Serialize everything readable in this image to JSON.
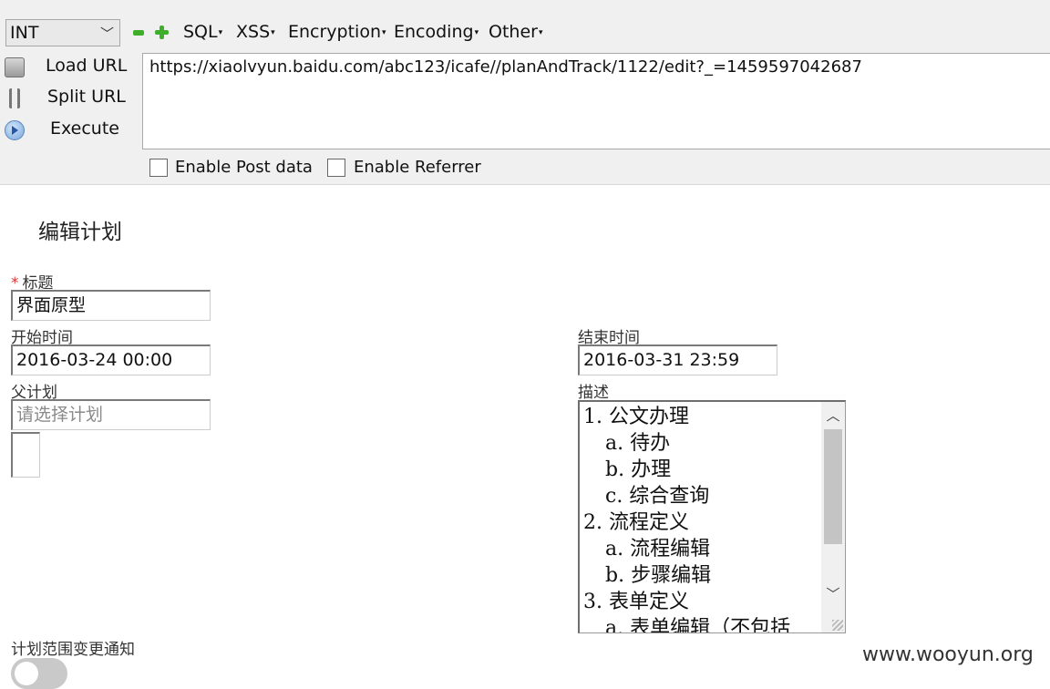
{
  "hackbar": {
    "type_select": "INT",
    "menus": {
      "sql": "SQL",
      "xss": "XSS",
      "encryption": "Encryption",
      "encoding": "Encoding",
      "other": "Other"
    },
    "buttons": {
      "load_url": "Load URL",
      "split_url": "Split URL",
      "execute": "Execute"
    },
    "url": "https://xiaolvyun.baidu.com/abc123/icafe//planAndTrack/1122/edit?_=1459597042687",
    "checkboxes": {
      "post_data": "Enable Post data",
      "referrer": "Enable Referrer"
    },
    "icons": {
      "minus": "minus-icon",
      "plus": "plus-icon",
      "load": "load-url-icon",
      "split": "scissors-icon",
      "execute": "play-icon"
    },
    "colors": {
      "accent_green": "#3fae2a"
    }
  },
  "page": {
    "title": "编辑计划",
    "title_field": {
      "required_mark": "*",
      "label": "标题",
      "value": "界面原型"
    },
    "start_time": {
      "label": "开始时间",
      "value": "2016-03-24 00:00"
    },
    "end_time": {
      "label": "结束时间",
      "value": "2016-03-31 23:59"
    },
    "parent_plan": {
      "label": "父计划",
      "placeholder": "请选择计划"
    },
    "description": {
      "label": "描述",
      "lines": [
        "1. 公文办理",
        "a. 待办",
        "b. 办理",
        "c. 综合查询",
        "2. 流程定义",
        "a. 流程编辑",
        "b. 步骤编辑",
        "3. 表单定义",
        "a. 表单编辑（不包括"
      ]
    },
    "notify": {
      "label": "计划范围变更通知",
      "enabled": false
    },
    "colors": {
      "required": "#e03030"
    }
  },
  "watermark": "www.wooyun.org"
}
